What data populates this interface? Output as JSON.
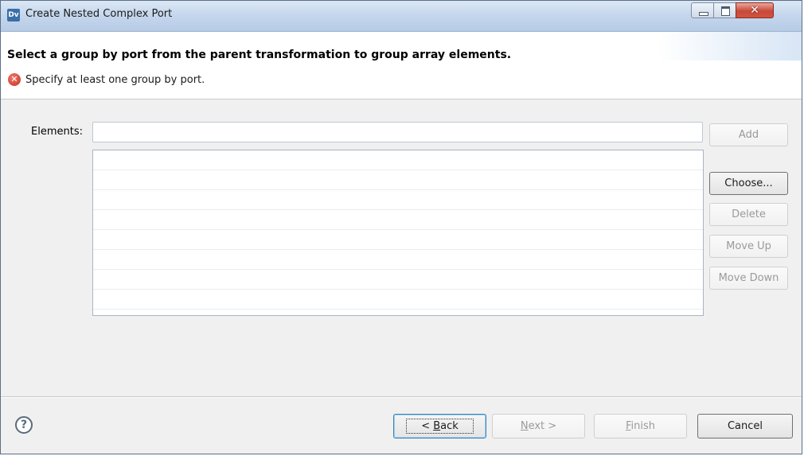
{
  "window": {
    "app_icon_text": "Dv",
    "title": "Create Nested Complex Port"
  },
  "header": {
    "heading": "Select a group by port from the parent transformation to group array elements.",
    "error_message": "Specify at least one group by port."
  },
  "form": {
    "elements_label": "Elements:",
    "elements_value": "",
    "list_rows": [
      "",
      "",
      "",
      "",
      "",
      "",
      "",
      ""
    ]
  },
  "side_buttons": {
    "add": "Add",
    "choose": "Choose...",
    "delete": "Delete",
    "move_up": "Move Up",
    "move_down": "Move Down"
  },
  "footer": {
    "help_glyph": "?",
    "back_prefix": "< ",
    "back_mnemonic": "B",
    "back_rest": "ack",
    "next_mnemonic": "N",
    "next_rest": "ext >",
    "finish_mnemonic": "F",
    "finish_rest": "inish",
    "cancel": "Cancel"
  },
  "colors": {
    "accent_border": "#3c7fb1",
    "error_red": "#c2311f",
    "disabled_text": "#9a9a9a"
  }
}
